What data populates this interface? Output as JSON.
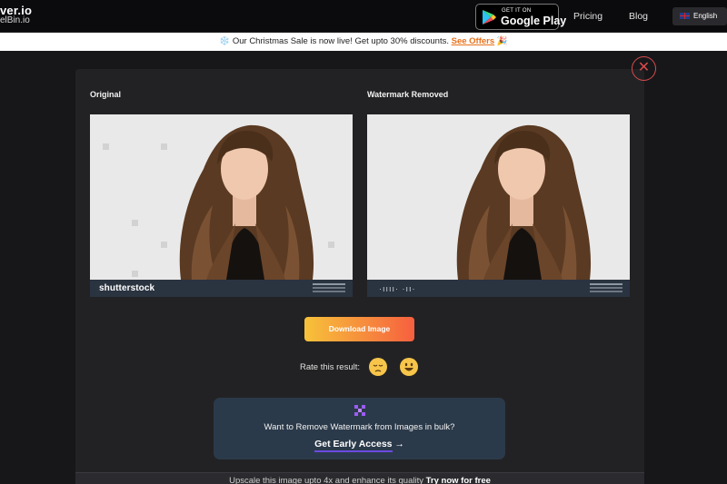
{
  "header": {
    "brand_line1": "ver.io",
    "brand_line2": "elBin.io",
    "google_play_small": "GET IT ON",
    "google_play_big": "Google Play",
    "nav": [
      "Pricing",
      "Blog"
    ],
    "language": "English"
  },
  "promo": {
    "emoji_left": "❄️",
    "text": "Our Christmas Sale is now live! Get upto 30% discounts.",
    "link": "See Offers",
    "emoji_right": "🎉"
  },
  "result": {
    "original_label": "Original",
    "removed_label": "Watermark Removed",
    "stock_logo": "shutterstock",
    "download_label": "Download Image",
    "rate_label": "Rate this result:"
  },
  "bulk": {
    "text": "Want to Remove Watermark from Images in bulk?",
    "cta": "Get Early Access",
    "arrow": "→"
  },
  "footer": {
    "text": "Upscale this image upto 4x and enhance its quality",
    "link": "Try now for free"
  },
  "colors": {
    "accent_orange": "#e8701a",
    "close_red": "#d94b4b",
    "gradient_start": "#f7c23a",
    "gradient_end": "#f6603f",
    "bulk_bg": "#2b3a4a"
  }
}
